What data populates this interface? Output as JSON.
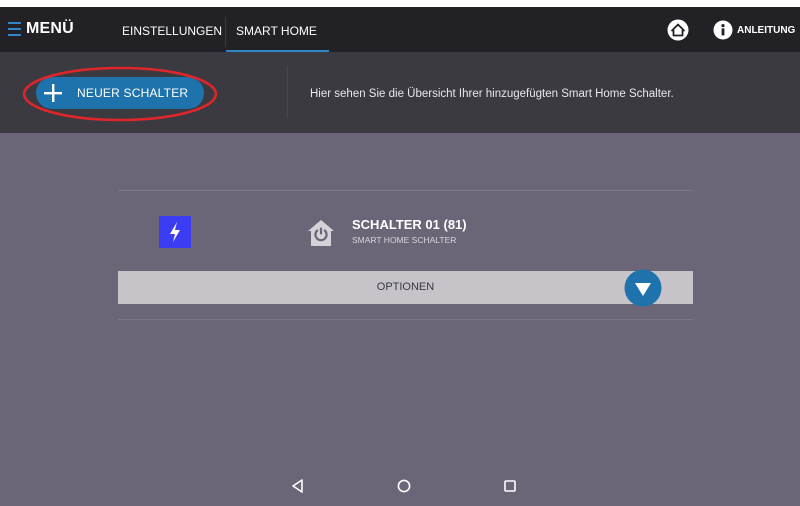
{
  "topbar": {
    "menu_label": "MENÜ",
    "tabs": [
      {
        "label": "EINSTELLUNGEN",
        "active": false
      },
      {
        "label": "SMART HOME",
        "active": true
      }
    ],
    "help_label": "ANLEITUNG"
  },
  "actionbar": {
    "new_switch_label": "NEUER SCHALTER",
    "info_text": "Hier sehen Sie die Übersicht Ihrer hinzugefügten Smart Home Schalter."
  },
  "switches": [
    {
      "name": "SCHALTER 01 (81)",
      "type": "SMART HOME SCHALTER",
      "icon": "lightning-bolt-icon",
      "options_label": "OPTIONEN"
    }
  ],
  "android_nav": [
    "back-icon",
    "home-circle-icon",
    "recent-apps-icon"
  ],
  "colors": {
    "accent": "#2f86c6",
    "button_blue": "#1f73ad",
    "topbar_bg": "#222126",
    "actionbar_bg": "#3b3a40",
    "content_bg": "#6b6577",
    "bolt_bg": "#3c3cf2",
    "highlight_ellipse": "#e0262b"
  }
}
